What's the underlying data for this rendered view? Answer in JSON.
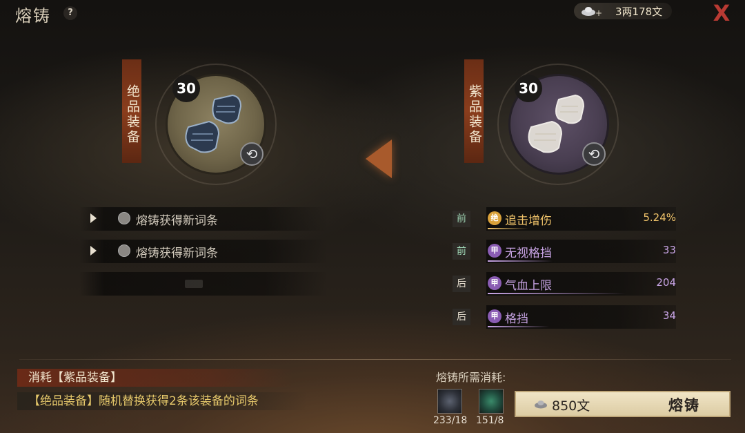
{
  "header": {
    "title": "熔铸",
    "help_label": "?",
    "currency_plus": "+",
    "currency_amount": "3两178文",
    "close_label": "X"
  },
  "equipment": {
    "left": {
      "grade_label": "绝品装备",
      "level": "30",
      "icon": "blue-gauntlets-icon",
      "swap_icon": "swap-icon"
    },
    "right": {
      "grade_label": "紫品装备",
      "level": "30",
      "icon": "white-gauntlets-icon",
      "swap_icon": "swap-icon"
    }
  },
  "left_attributes": [
    {
      "text": "熔铸获得新词条"
    },
    {
      "text": "熔铸获得新词条"
    }
  ],
  "right_attributes": [
    {
      "tag": "前",
      "badge": "绝",
      "name": "追击增伤",
      "value": "5.24%",
      "color": "#f0c36a",
      "badge_color": "#d9a13a",
      "fill": 0.25
    },
    {
      "tag": "前",
      "badge": "甲",
      "name": "无视格挡",
      "value": "33",
      "color": "#c9a5e6",
      "badge_color": "#8a5cb3",
      "fill": 0.4
    },
    {
      "tag": "后",
      "badge": "甲",
      "name": "气血上限",
      "value": "204",
      "color": "#c9a5e6",
      "badge_color": "#8a5cb3",
      "fill": 0.85
    },
    {
      "tag": "后",
      "badge": "甲",
      "name": "格挡",
      "value": "34",
      "color": "#c9a5e6",
      "badge_color": "#8a5cb3",
      "fill": 0.38
    }
  ],
  "footer": {
    "consume_label": "消耗【紫品装备】",
    "description": "【绝品装备】随机替换获得2条该装备的词条",
    "required_label": "熔铸所需消耗:",
    "materials": [
      {
        "icon": "dark-ore-icon",
        "count": "233/18"
      },
      {
        "icon": "jade-stone-icon",
        "count": "151/8"
      }
    ],
    "cost": "850文",
    "forge_button": "熔铸"
  }
}
